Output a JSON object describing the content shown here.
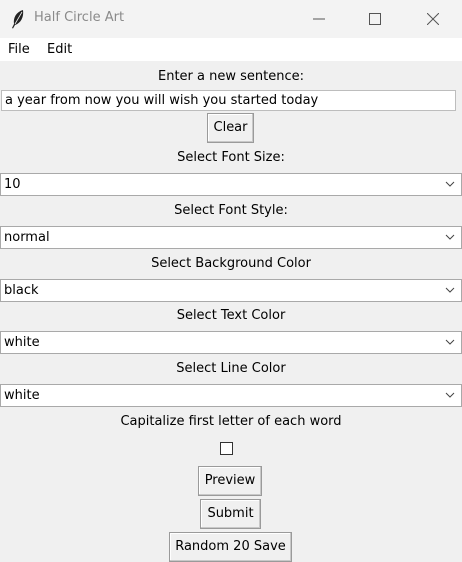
{
  "window": {
    "title": "Half Circle Art"
  },
  "menu": {
    "file": "File",
    "edit": "Edit"
  },
  "sentence": {
    "label": "Enter a new sentence:",
    "value": "a year from now you will wish you started today",
    "clear_label": "Clear"
  },
  "font_size": {
    "label": "Select Font Size:",
    "value": "10"
  },
  "font_style": {
    "label": "Select Font Style:",
    "value": "normal"
  },
  "bg_color": {
    "label": "Select Background Color",
    "value": "black"
  },
  "text_color": {
    "label": "Select Text Color",
    "value": "white"
  },
  "line_color": {
    "label": "Select Line Color",
    "value": "white"
  },
  "capitalize": {
    "label": "Capitalize first letter of each word",
    "checked": false
  },
  "buttons": {
    "preview": "Preview",
    "submit": "Submit",
    "random": "Random 20 Save"
  }
}
